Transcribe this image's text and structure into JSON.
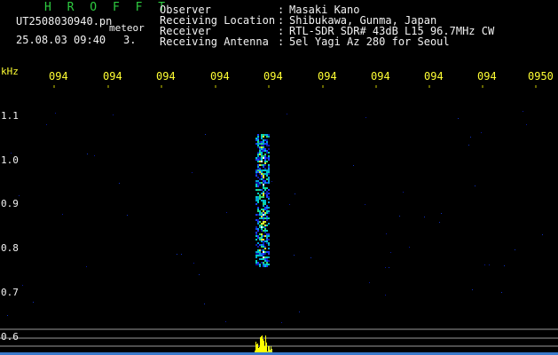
{
  "header": {
    "title": "H R O F F T",
    "filename": "UT2508030940.pn",
    "detection": "meteor",
    "datetime": "25.08.03 09:40",
    "count": "3."
  },
  "info": [
    {
      "label": "Observer",
      "colon": ":",
      "value": "Masaki Kano"
    },
    {
      "label": "Receiving Location",
      "colon": ":",
      "value": "Shibukawa, Gunma, Japan"
    },
    {
      "label": "Receiver",
      "colon": ":",
      "value": "RTL-SDR SDR# 43dB L15 96.7MHz CW"
    },
    {
      "label": "Receiving Antenna",
      "colon": ":",
      "value": "5el Yagi Az 280 for Seoul"
    }
  ],
  "axes": {
    "freq_unit": "kHz",
    "time_ticks": [
      "094",
      "094",
      "094",
      "094",
      "094",
      "094",
      "094",
      "094",
      "094",
      "0950"
    ],
    "freq_ticks": [
      "1.1",
      "1.0",
      "0.9",
      "0.8",
      "0.7",
      "0.6"
    ]
  },
  "colors": {
    "background": "#000000",
    "title": "#2ecc40",
    "text": "#f2f2f2",
    "axis_labels": "#ffff33",
    "spectrum_low": "#0000cc",
    "spectrum_mid": "#00cccc",
    "spectrum_high": "#ffff00"
  }
}
